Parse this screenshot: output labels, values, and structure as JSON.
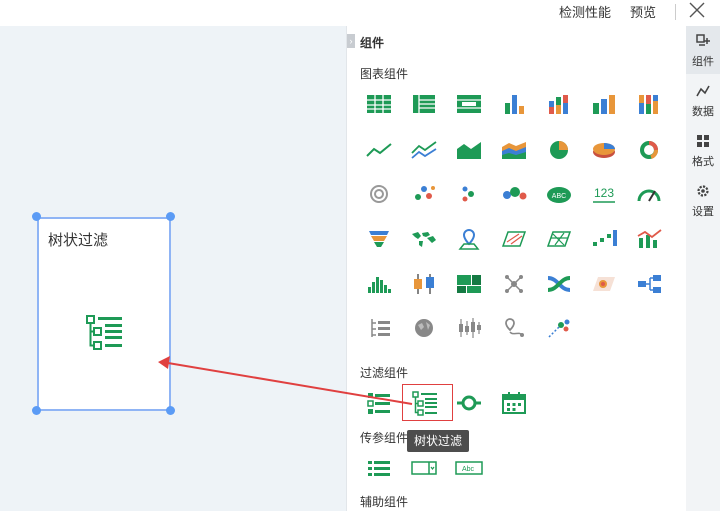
{
  "topbar": {
    "check_label": "检测性能",
    "preview_label": "预览"
  },
  "canvas": {
    "widget_title": "树状过滤"
  },
  "panel": {
    "title": "组件",
    "sections": {
      "chart": "图表组件",
      "filter": "过滤组件",
      "param": "传参组件",
      "aux": "辅助组件"
    },
    "tooltip": "树状过滤",
    "text_glyphs": {
      "abc": "ABC",
      "num": "123",
      "abc_input": "Abc"
    }
  },
  "rightbar": {
    "items": [
      "组件",
      "数据",
      "格式",
      "设置"
    ]
  },
  "colors": {
    "green": "#1e9a56",
    "selection": "#e04040",
    "handle": "#5b9bf5"
  }
}
